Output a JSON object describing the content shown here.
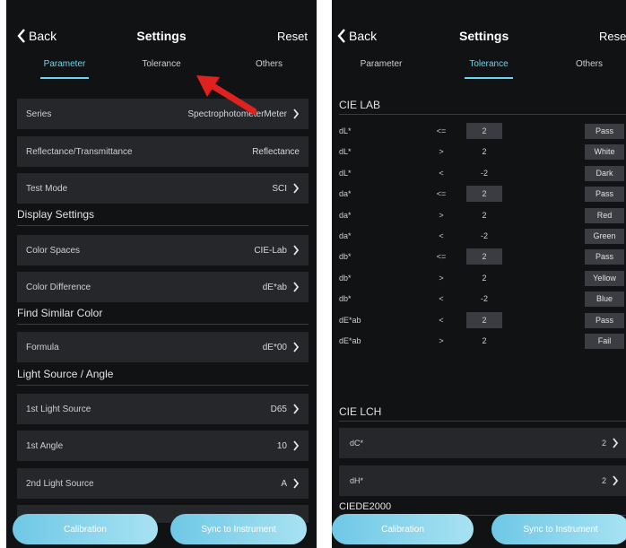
{
  "colors": {
    "accent": "#6ad6f0",
    "background": "#111214",
    "row": "#26272b",
    "annotation": "#e0221f"
  },
  "left": {
    "header": {
      "back": "Back",
      "title": "Settings",
      "reset": "Reset"
    },
    "tabs": [
      {
        "label": "Parameter",
        "active": true
      },
      {
        "label": "Tolerance",
        "active": false
      },
      {
        "label": "Others",
        "active": false
      }
    ],
    "rows": {
      "series": {
        "label": "Series",
        "value": "SpectrophotometerMeter"
      },
      "reflectance": {
        "label": "Reflectance/Transmittance",
        "value": "Reflectance"
      },
      "test_mode": {
        "label": "Test Mode",
        "value": "SCI"
      },
      "color_spaces": {
        "label": "Color Spaces",
        "value": "CIE-Lab"
      },
      "color_difference": {
        "label": "Color Difference",
        "value": "dE*ab"
      },
      "formula": {
        "label": "Formula",
        "value": "dE*00"
      },
      "light_source_1": {
        "label": "1st Light Source",
        "value": "D65"
      },
      "angle_1": {
        "label": "1st Angle",
        "value": "10"
      },
      "light_source_2": {
        "label": "2nd Light Source",
        "value": "A"
      }
    },
    "sections": {
      "display": "Display Settings",
      "similar": "Find Similar Color",
      "light": "Light Source / Angle"
    },
    "buttons": {
      "calibration": "Calibration",
      "sync": "Sync to Instrument"
    }
  },
  "right": {
    "header": {
      "back": "Back",
      "title": "Settings",
      "reset": "Reset"
    },
    "tabs": [
      {
        "label": "Parameter",
        "active": false
      },
      {
        "label": "Tolerance",
        "active": true
      },
      {
        "label": "Others",
        "active": false
      }
    ],
    "sections": {
      "lab": "CIE LAB",
      "lch": "CIE LCH",
      "de2000": "CIEDE2000"
    },
    "lab_rows": [
      {
        "param": "dL*",
        "op": "<=",
        "value": "2",
        "result": "Pass",
        "boxed": true
      },
      {
        "param": "dL*",
        "op": ">",
        "value": "2",
        "result": "White",
        "boxed": false
      },
      {
        "param": "dL*",
        "op": "<",
        "value": "-2",
        "result": "Dark",
        "boxed": false
      },
      {
        "param": "da*",
        "op": "<=",
        "value": "2",
        "result": "Pass",
        "boxed": true
      },
      {
        "param": "da*",
        "op": ">",
        "value": "2",
        "result": "Red",
        "boxed": false
      },
      {
        "param": "da*",
        "op": "<",
        "value": "-2",
        "result": "Green",
        "boxed": false
      },
      {
        "param": "db*",
        "op": "<=",
        "value": "2",
        "result": "Pass",
        "boxed": true
      },
      {
        "param": "db*",
        "op": ">",
        "value": "2",
        "result": "Yellow",
        "boxed": false
      },
      {
        "param": "db*",
        "op": "<",
        "value": "-2",
        "result": "Blue",
        "boxed": false
      },
      {
        "param": "dE*ab",
        "op": "<",
        "value": "2",
        "result": "Pass",
        "boxed": true
      },
      {
        "param": "dE*ab",
        "op": ">",
        "value": "2",
        "result": "Fail",
        "boxed": false
      }
    ],
    "lch_rows": [
      {
        "label": "dC*",
        "value": "2"
      },
      {
        "label": "dH*",
        "value": "2"
      }
    ],
    "buttons": {
      "calibration": "Calibration",
      "sync": "Sync to Instrument"
    }
  }
}
